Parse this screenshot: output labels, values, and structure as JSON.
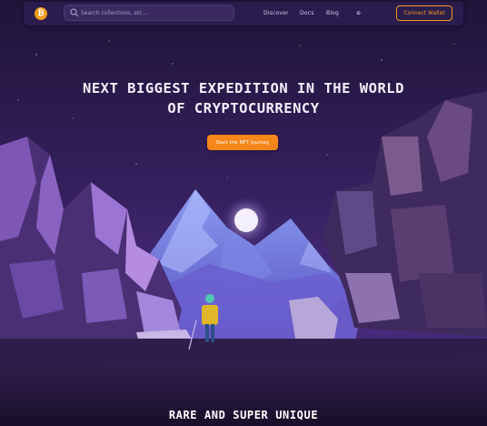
{
  "nav": {
    "logo_symbol": "₿",
    "search_placeholder": "Search collections, etc...",
    "links": [
      {
        "label": "Discover"
      },
      {
        "label": "Docs"
      },
      {
        "label": "Blog"
      },
      {
        "label": "⊕"
      }
    ],
    "connect_label": "Connect Wallet"
  },
  "hero": {
    "title_line1": "Next Biggest Expedition in the World",
    "title_line2": "of Cryptocurrency",
    "cta_label": "Start the NFT Journey"
  },
  "section": {
    "heading": "Rare and Super Unique"
  },
  "colors": {
    "accent": "#f5861a",
    "sky_top": "#2a1a4d",
    "sky_bottom": "#4b2a7a",
    "ground": "#1c1230"
  },
  "icons": {
    "logo": "bitcoin-icon",
    "search": "search-icon"
  }
}
